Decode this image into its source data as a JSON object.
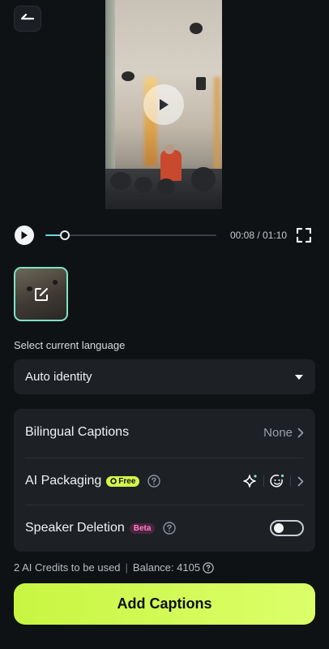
{
  "header": {
    "back_icon": "back-arrow-icon"
  },
  "player": {
    "current_time": "00:08",
    "duration": "01:10",
    "time_display": "00:08 / 01:10",
    "progress_fraction": 0.114
  },
  "language": {
    "label": "Select current language",
    "selected": "Auto identity"
  },
  "options": {
    "bilingual": {
      "label": "Bilingual Captions",
      "value": "None"
    },
    "ai_packaging": {
      "label": "AI Packaging",
      "badge": "Free"
    },
    "speaker_deletion": {
      "label": "Speaker Deletion",
      "badge": "Beta",
      "enabled": false
    }
  },
  "credits": {
    "usage": "2 AI Credits to be used",
    "balance": "Balance: 4105"
  },
  "actions": {
    "primary_label": "Add Captions"
  },
  "colors": {
    "accent": "#c8f542",
    "progress": "#6fd3e8",
    "thumbnail_border": "#7ee3c6"
  }
}
